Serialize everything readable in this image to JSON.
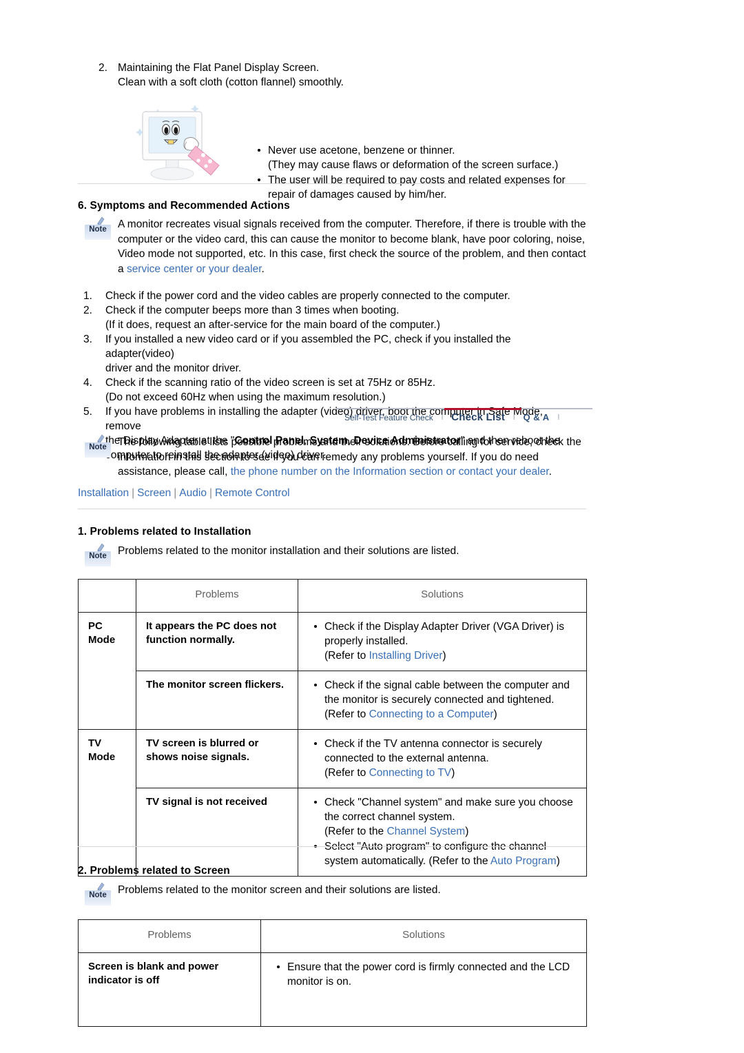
{
  "maintain": {
    "number": "2.",
    "line1": "Maintaining the Flat Panel Display Screen.",
    "line2": "Clean with a soft cloth (cotton flannel) smoothly.",
    "bullets": [
      "Never use acetone, benzene or thinner.\n(They may cause flaws or deformation of the screen surface.)",
      "The user will be required to pay costs and related expenses for repair of damages caused by him/her."
    ],
    "bullet1_a": "Never use acetone, benzene or thinner.",
    "bullet1_b": "(They may cause flaws or deformation of the screen surface.)",
    "bullet2_a": "The user will be required to pay costs and related expenses for",
    "bullet2_b": "repair of damages caused by him/her.",
    "illustration_alt": "monitor-cleaning-illustration"
  },
  "symptoms": {
    "heading": "6. Symptoms and Recommended Actions",
    "note_label": "Note",
    "note_text_plain": "A monitor recreates visual signals received from the computer. Therefore, if there is trouble with the computer or the video card, this can cause the monitor to become blank, have poor coloring, noise, Video mode not supported, etc. In this case, first check the source of the problem, and then contact a ",
    "note_link": "service center or your dealer",
    "note_tail": ".",
    "steps": [
      {
        "num": "1.",
        "text": "Check if the power cord and the video cables are properly connected to the computer."
      },
      {
        "num": "2.",
        "text": "Check if the computer beeps more than 3 times when booting.",
        "text2": "(If it does, request an after-service for the main board of the computer.)"
      },
      {
        "num": "3.",
        "text": "If you installed a new video card or if you assembled the PC, check if you installed the adapter(video)",
        "text2": "driver and the monitor driver."
      },
      {
        "num": "4.",
        "text": "Check if the scanning ratio of the video screen is set at 75Hz or 85Hz.",
        "text2": "(Do not exceed 60Hz when using the maximum resolution.)"
      },
      {
        "num": "5.",
        "text_pre": "If you have problems in installing the adapter (video) driver, boot the computer in Safe Mode, remove",
        "text_line2_pre": "the Display Adapter at the \"",
        "bold1": "Control Panel",
        "mid1": ", ",
        "bold2": "System",
        "mid2": ", ",
        "bold3": "Device Administrator",
        "text_line2_post": "\" and then reboot the",
        "text_line3": "computer to reinstall the adapter (video) driver."
      }
    ]
  },
  "tabs": {
    "items": [
      {
        "label": "Self-Test Feature Check",
        "active": false
      },
      {
        "label": "Check List",
        "active": true
      },
      {
        "label": "Q & A",
        "active": false
      }
    ],
    "separator": "l",
    "active_color": "#b4122a"
  },
  "following": {
    "note_label": "Note",
    "text_plain": "The following table lists possible problems and their solutions. Before calling for service, check the information in this section to see if you can remedy any problems yourself. If you do need assistance, please call, ",
    "link": "the phone number on the Information section or contact your dealer",
    "tail": "."
  },
  "navlinks": {
    "items": [
      "Installation",
      "Screen",
      "Audio",
      "Remote Control"
    ],
    "separator": "|"
  },
  "install_section": {
    "heading": "1. Problems related to Installation",
    "note_label": "Note",
    "note_text": "Problems related to the monitor installation and their solutions are listed.",
    "table": {
      "headers": [
        "",
        "Problems",
        "Solutions"
      ],
      "rows": [
        {
          "mode": "PC\nMode",
          "mode_line1": "PC",
          "mode_line2": "Mode",
          "mode_rowspan": 2,
          "problem_line1": "It appears the PC does not",
          "problem_line2": "function normally.",
          "solutions": [
            {
              "line1": "Check if the Display Adapter Driver (VGA Driver) is",
              "line2": "properly installed.",
              "line3_pre": "(Refer to ",
              "line3_link": "Installing Driver",
              "line3_post": ")"
            }
          ]
        },
        {
          "mode": "",
          "problem_line1": "The monitor screen flickers.",
          "problem_line2": "",
          "solutions": [
            {
              "line1": "Check if the signal cable between the computer and",
              "line2": "the monitor is securely connected and tightened.",
              "line3_pre": "(Refer to ",
              "line3_link": "Connecting to a Computer",
              "line3_post": ")"
            }
          ]
        },
        {
          "mode": "TV\nMode",
          "mode_line1": "TV",
          "mode_line2": "Mode",
          "mode_rowspan": 2,
          "problem_line1": "TV screen is blurred or",
          "problem_line2": "shows noise signals.",
          "solutions": [
            {
              "line1": "Check if the TV antenna connector is securely",
              "line2": "connected to the external antenna.",
              "line3_pre": "(Refer to ",
              "line3_link": "Connecting to TV",
              "line3_post": ")"
            }
          ]
        },
        {
          "mode": "",
          "problem_line1": "TV signal is not received",
          "problem_line2": "",
          "solutions": [
            {
              "line1": "Check \"Channel system\" and make sure you choose",
              "line2": "the correct channel system.",
              "line3_pre": "(Refer to the ",
              "line3_link": "Channel System",
              "line3_post": ")"
            },
            {
              "line1": "Select \"Auto program\" to configure the channel",
              "line2_pre": "system automatically. (Refer to the ",
              "line2_link": "Auto Program",
              "line2_post": ")"
            }
          ]
        }
      ]
    }
  },
  "screen_section": {
    "heading": "2. Problems related to Screen",
    "note_label": "Note",
    "note_text": "Problems related to the monitor screen and their solutions are listed.",
    "table": {
      "headers": [
        "Problems",
        "Solutions"
      ],
      "rows": [
        {
          "problem_line1": "Screen is blank and power",
          "problem_line2": "indicator is off",
          "solution_line1": "Ensure that the power cord is firmly connected and the LCD",
          "solution_line2": "monitor is on."
        }
      ]
    }
  }
}
